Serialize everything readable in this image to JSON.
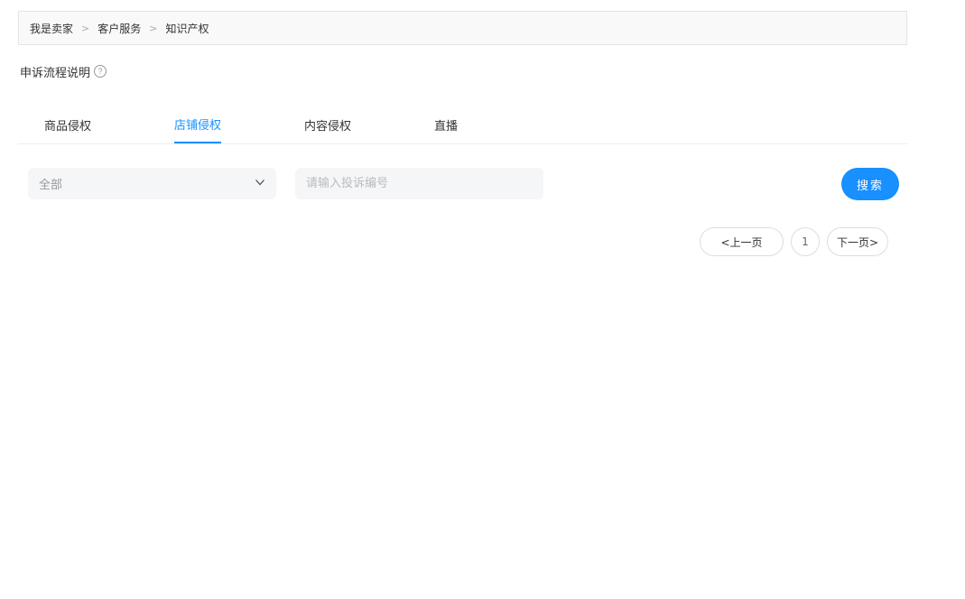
{
  "breadcrumb": {
    "items": [
      "我是卖家",
      "客户服务",
      "知识产权"
    ],
    "separator": ">"
  },
  "title": {
    "text": "申诉流程说明",
    "help_icon": "?"
  },
  "tabs": [
    {
      "label": "商品侵权",
      "active": false
    },
    {
      "label": "店铺侵权",
      "active": true
    },
    {
      "label": "内容侵权",
      "active": false
    },
    {
      "label": "直播",
      "active": false
    }
  ],
  "filters": {
    "select_value": "全部",
    "search_placeholder": "请输入投诉编号",
    "search_value": "",
    "search_button": "搜索"
  },
  "pagination": {
    "prev": "<上一页",
    "current_page": "1",
    "next": "下一页>"
  },
  "colors": {
    "accent": "#1890ff",
    "field_bg": "#f5f6f8",
    "breadcrumb_bg": "#f9f9f9"
  }
}
